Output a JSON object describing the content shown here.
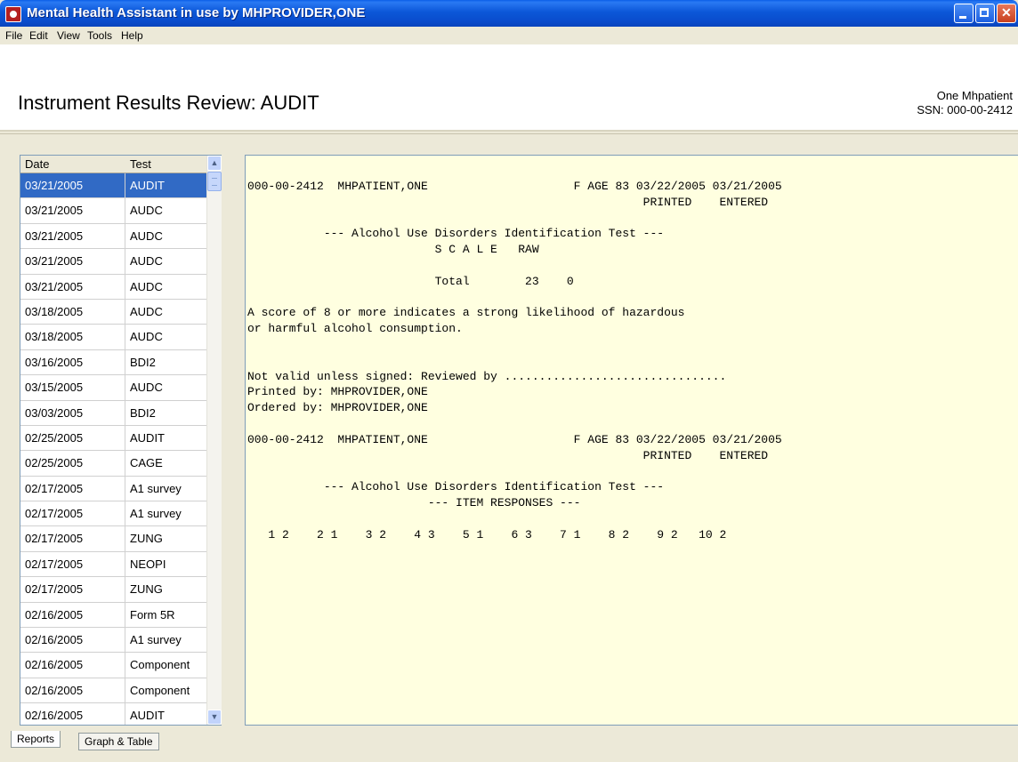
{
  "window": {
    "title": "Mental Health Assistant in use by MHPROVIDER,ONE"
  },
  "menu": [
    "File",
    "Edit",
    "View",
    "Tools",
    "Help"
  ],
  "header": {
    "title": "Instrument Results Review: AUDIT",
    "patient_name": "One Mhpatient",
    "patient_ssn": "SSN: 000-00-2412"
  },
  "list": {
    "columns": [
      "Date",
      "Test"
    ],
    "rows": [
      {
        "date": "03/21/2005",
        "test": "AUDIT",
        "selected": true
      },
      {
        "date": "03/21/2005",
        "test": "AUDC"
      },
      {
        "date": "03/21/2005",
        "test": "AUDC"
      },
      {
        "date": "03/21/2005",
        "test": "AUDC"
      },
      {
        "date": "03/21/2005",
        "test": "AUDC"
      },
      {
        "date": "03/18/2005",
        "test": "AUDC"
      },
      {
        "date": "03/18/2005",
        "test": "AUDC"
      },
      {
        "date": "03/16/2005",
        "test": "BDI2"
      },
      {
        "date": "03/15/2005",
        "test": "AUDC"
      },
      {
        "date": "03/03/2005",
        "test": "BDI2"
      },
      {
        "date": "02/25/2005",
        "test": "AUDIT"
      },
      {
        "date": "02/25/2005",
        "test": "CAGE"
      },
      {
        "date": "02/17/2005",
        "test": "A1 survey"
      },
      {
        "date": "02/17/2005",
        "test": "A1 survey"
      },
      {
        "date": "02/17/2005",
        "test": "ZUNG"
      },
      {
        "date": "02/17/2005",
        "test": "NEOPI"
      },
      {
        "date": "02/17/2005",
        "test": "ZUNG"
      },
      {
        "date": "02/16/2005",
        "test": "Form 5R"
      },
      {
        "date": "02/16/2005",
        "test": "A1 survey"
      },
      {
        "date": "02/16/2005",
        "test": "Component"
      },
      {
        "date": "02/16/2005",
        "test": "Component"
      },
      {
        "date": "02/16/2005",
        "test": "AUDIT"
      }
    ]
  },
  "report": {
    "text": "000-00-2412  MHPATIENT,ONE                     F AGE 83 03/22/2005 03/21/2005\n                                                         PRINTED    ENTERED\n\n           --- Alcohol Use Disorders Identification Test ---\n                           S C A L E   RAW\n\n                           Total        23    0\n\nA score of 8 or more indicates a strong likelihood of hazardous\nor harmful alcohol consumption.\n\n\nNot valid unless signed: Reviewed by ................................\nPrinted by: MHPROVIDER,ONE\nOrdered by: MHPROVIDER,ONE\n\n000-00-2412  MHPATIENT,ONE                     F AGE 83 03/22/2005 03/21/2005\n                                                         PRINTED    ENTERED\n\n           --- Alcohol Use Disorders Identification Test ---\n                          --- ITEM RESPONSES ---\n\n   1 2    2 1    3 2    4 3    5 1    6 3    7 1    8 2    9 2   10 2"
  },
  "tabs": [
    {
      "label": "Reports",
      "active": true
    },
    {
      "label": "Graph & Table",
      "active": false
    }
  ]
}
